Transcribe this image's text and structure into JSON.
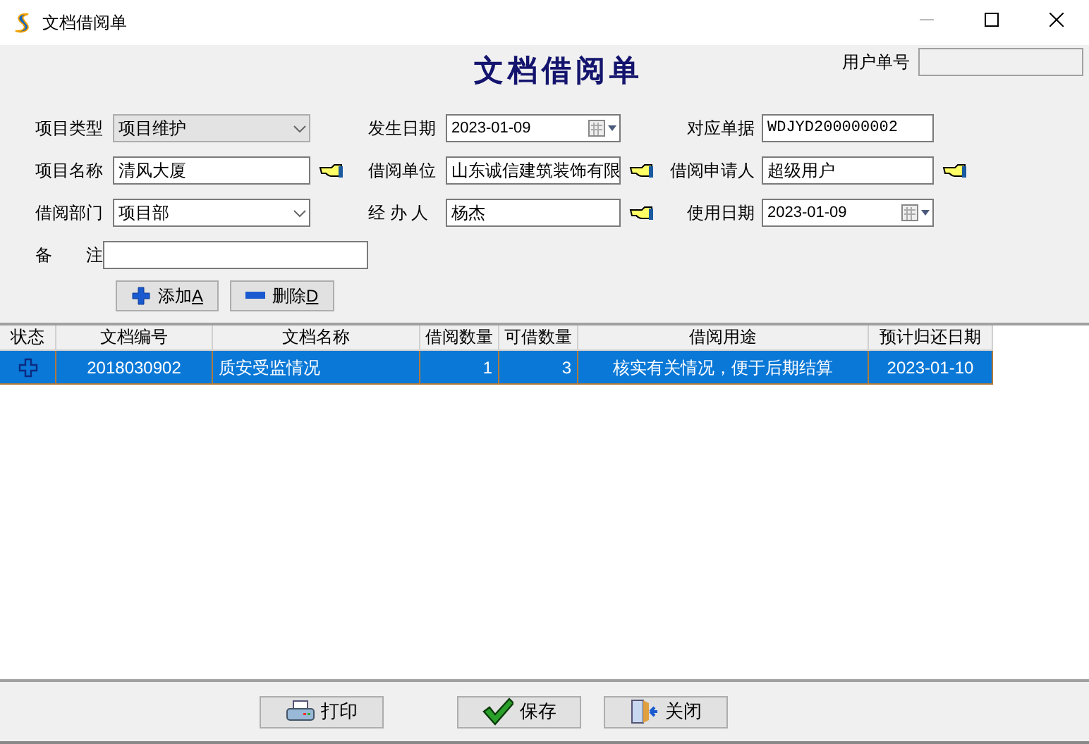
{
  "window": {
    "title": "文档借阅单"
  },
  "header": {
    "title": "文档借阅单",
    "user_no": {
      "label": "用户单号"
    }
  },
  "form": {
    "rows": [
      [
        {
          "label": "项目类型",
          "kind": "combo",
          "value": "项目维护",
          "disabled": true,
          "lookup": false
        },
        {
          "label": "发生日期",
          "kind": "date",
          "value": "2023-01-09",
          "lookup": false
        },
        {
          "label": "对应单据",
          "kind": "text",
          "value": "WDJYD200000002",
          "lookup": false
        }
      ],
      [
        {
          "label": "项目名称",
          "kind": "text",
          "value": "清风大厦",
          "lookup": true
        },
        {
          "label": "借阅单位",
          "kind": "text",
          "value": "山东诚信建筑装饰有限",
          "lookup": true
        },
        {
          "label": "借阅申请人",
          "kind": "text",
          "value": "超级用户",
          "lookup": true
        }
      ],
      [
        {
          "label": "借阅部门",
          "kind": "combo",
          "value": "项目部",
          "disabled": false,
          "lookup": false
        },
        {
          "label": "经 办 人",
          "kind": "text",
          "value": "杨杰",
          "lookup": true
        },
        {
          "label": "使用日期",
          "kind": "date",
          "value": "2023-01-09",
          "lookup": false
        }
      ],
      [
        {
          "label": "备　　注",
          "kind": "wide",
          "lookup": false
        }
      ]
    ],
    "actions": [
      {
        "kind": "add",
        "label": "添加",
        "accelerator": "A"
      },
      {
        "kind": "delete",
        "label": "删除",
        "accelerator": "D"
      }
    ]
  },
  "table": {
    "columns": [
      "状态",
      "文档编号",
      "文档名称",
      "借阅数量",
      "可借数量",
      "借阅用途",
      "预计归还日期"
    ],
    "rows": [
      {
        "selected": true,
        "added": true,
        "cells": [
          "",
          "2018030902",
          "质安受监情况",
          "1",
          "3",
          "核实有关情况，便于后期结算",
          "2023-01-10"
        ]
      }
    ]
  },
  "footer": {
    "buttons": [
      {
        "kind": "print",
        "label": "打印"
      },
      {
        "kind": "save",
        "label": "保存"
      },
      {
        "kind": "close",
        "label": "关闭"
      }
    ]
  }
}
